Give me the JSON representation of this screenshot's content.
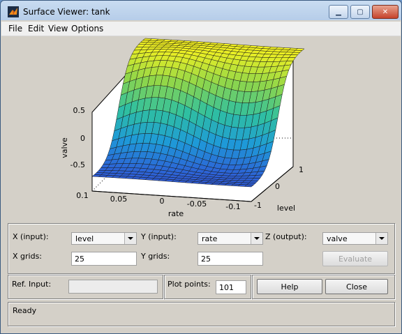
{
  "window": {
    "title": "Surface Viewer: tank"
  },
  "menu": [
    "File",
    "Edit",
    "View",
    "Options"
  ],
  "plot": {
    "zlabel": "valve",
    "xlabel": "rate",
    "ylabel": "level",
    "z_ticks": [
      "0.5",
      "0",
      "-0.5"
    ],
    "x_ticks": [
      "0.1",
      "0.05",
      "0",
      "-0.05",
      "-0.1"
    ],
    "y_ticks": [
      "-1",
      "0",
      "1"
    ]
  },
  "controls": {
    "x_input_label": "X (input):",
    "x_input_value": "level",
    "y_input_label": "Y (input):",
    "y_input_value": "rate",
    "z_output_label": "Z (output):",
    "z_output_value": "valve",
    "x_grids_label": "X grids:",
    "x_grids_value": "25",
    "y_grids_label": "Y grids:",
    "y_grids_value": "25",
    "evaluate_label": "Evaluate",
    "ref_input_label": "Ref. Input:",
    "ref_input_value": "",
    "plot_points_label": "Plot points:",
    "plot_points_value": "101",
    "help_label": "Help",
    "close_label": "Close"
  },
  "status": {
    "text": "Ready"
  }
}
